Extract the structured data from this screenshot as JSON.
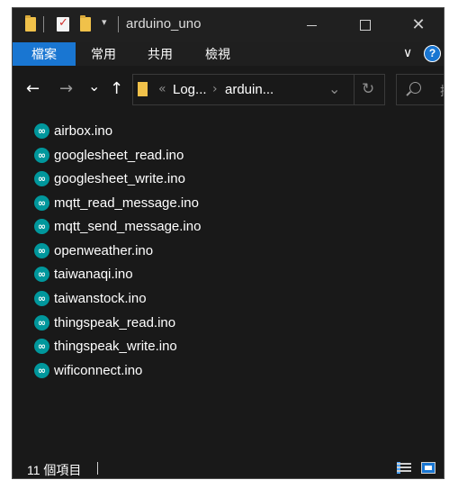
{
  "window": {
    "title": "arduino_uno",
    "close_glyph": "✕",
    "qat_dropdown": "▾"
  },
  "ribbon": {
    "tabs": [
      {
        "label": "檔案",
        "active": true
      },
      {
        "label": "常用",
        "active": false
      },
      {
        "label": "共用",
        "active": false
      },
      {
        "label": "檢視",
        "active": false
      }
    ],
    "expand_glyph": "∨",
    "help_glyph": "?"
  },
  "nav": {
    "back": "←",
    "forward": "→",
    "recent": "⌄",
    "up": "↑",
    "breadcrumb_overflow": "«",
    "breadcrumb": [
      "Log...",
      "arduin..."
    ],
    "breadcrumb_sep": "›",
    "address_dropdown": "⌄",
    "refresh": "↻",
    "search_placeholder": "搜"
  },
  "files": [
    "airbox.ino",
    "googlesheet_read.ino",
    "googlesheet_write.ino",
    "mqtt_read_message.ino",
    "mqtt_send_message.ino",
    "openweather.ino",
    "taiwanaqi.ino",
    "taiwanstock.ino",
    "thingspeak_read.ino",
    "thingspeak_write.ino",
    "wificonnect.ino"
  ],
  "file_icon_glyph": "∞",
  "status": {
    "count_text": "11 個項目"
  },
  "colors": {
    "accent": "#1976d2",
    "background": "#191919",
    "arduino": "#00979c",
    "folder": "#f0c14a"
  },
  "icons": [
    "folder-icon",
    "checklist-icon",
    "arduino-file-icon",
    "search-icon",
    "refresh-icon",
    "details-view-icon",
    "tiles-view-icon"
  ]
}
